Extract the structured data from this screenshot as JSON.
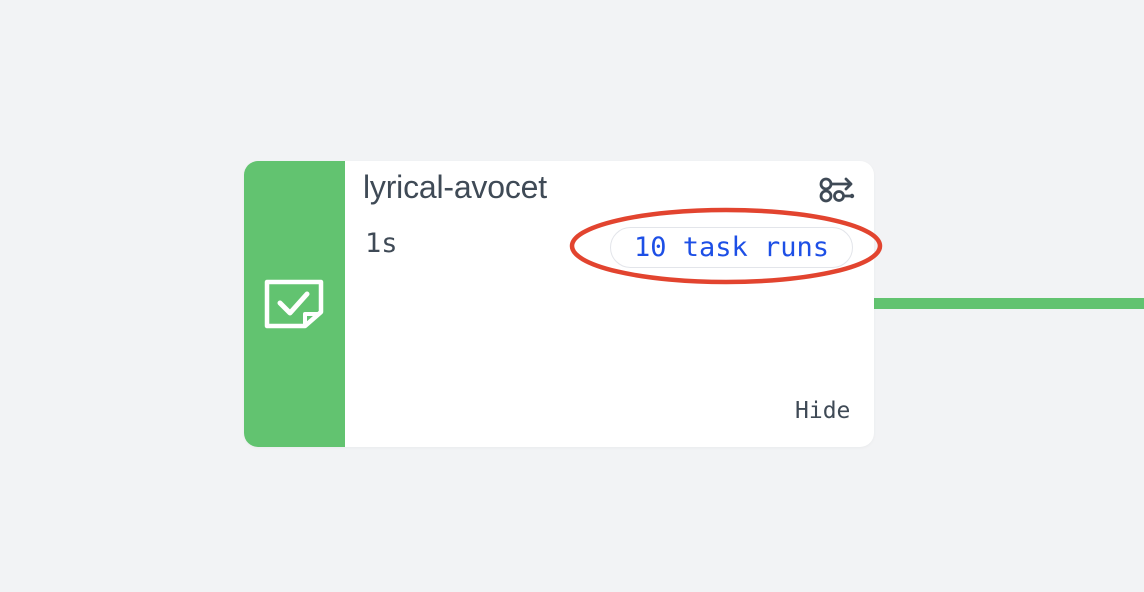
{
  "node": {
    "title": "lyrical-avocet",
    "duration": "1s",
    "task_runs_label": "10 task runs",
    "hide_label": "Hide",
    "status": "completed",
    "status_icon": "checkbox-checked-icon",
    "subflow_icon": "subflow-icon"
  },
  "colors": {
    "status_green": "#62c370",
    "link_blue": "#1d4fe6",
    "text_dark": "#3f4a56",
    "background": "#f2f3f5",
    "annotation_red": "#e2442f"
  }
}
